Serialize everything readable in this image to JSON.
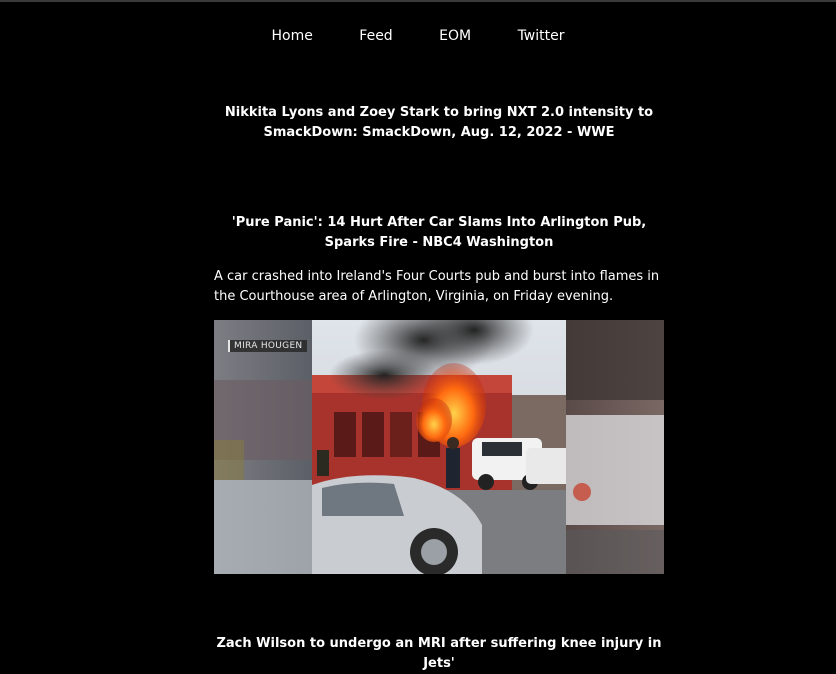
{
  "nav": {
    "items": [
      {
        "label": "Home"
      },
      {
        "label": "Feed"
      },
      {
        "label": "EOM"
      },
      {
        "label": "Twitter"
      }
    ]
  },
  "articles": [
    {
      "title": "Nikkita Lyons and Zoey Stark to bring NXT 2.0 intensity to SmackDown: SmackDown, Aug. 12, 2022 - WWE"
    },
    {
      "title": "'Pure Panic': 14 Hurt After Car Slams Into Arlington Pub, Sparks Fire - NBC4 Washington",
      "description": "A car crashed into Ireland's Four Courts pub and burst into flames in the Courthouse area of Arlington, Virginia, on Friday evening.",
      "image_watermark": "MIRA HOUGEN"
    },
    {
      "title": "Zach Wilson to undergo an MRI after suffering knee injury in Jets'"
    }
  ]
}
